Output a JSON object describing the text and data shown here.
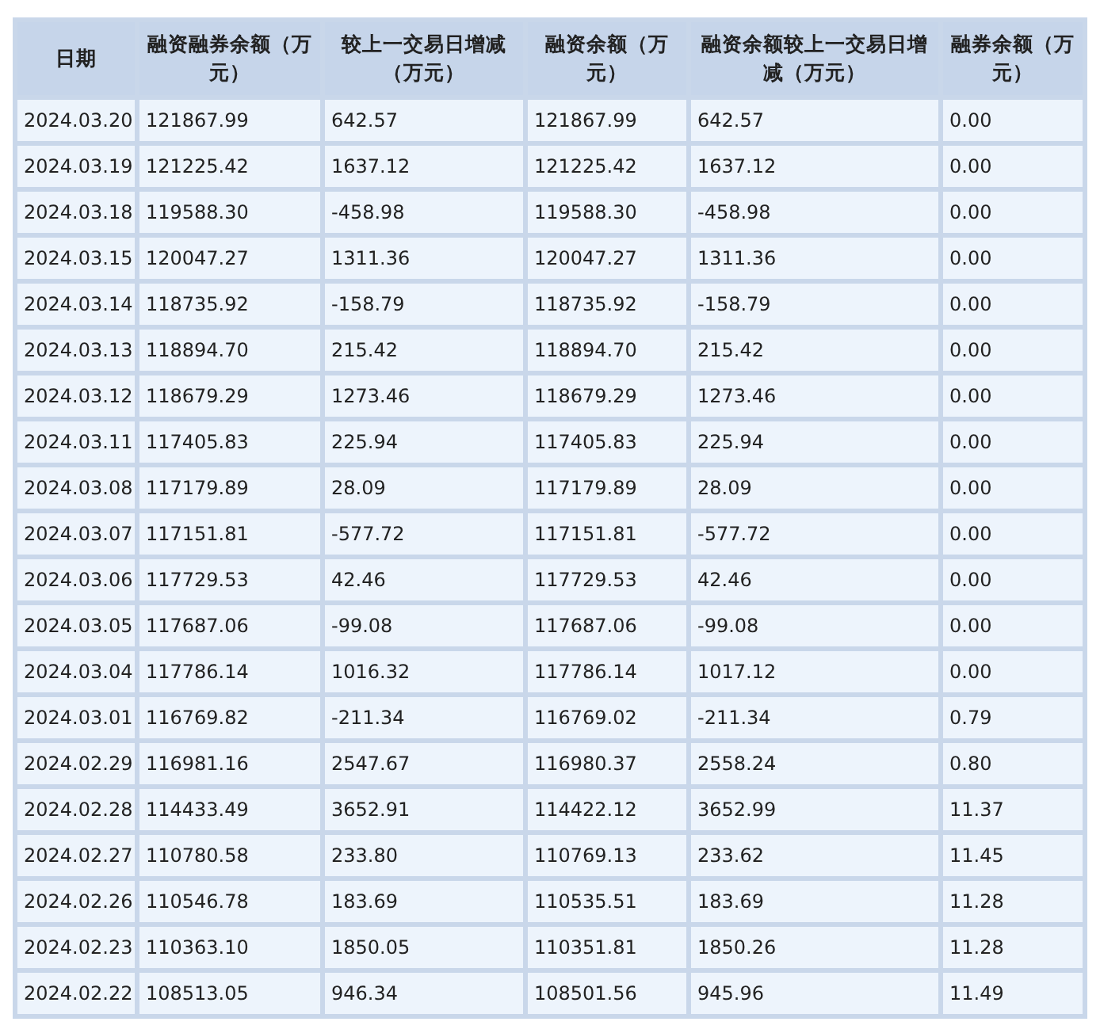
{
  "table": {
    "columns": [
      "日期",
      "融资融券余额（万元）",
      "较上一交易日增减（万元）",
      "融资余额（万元）",
      "融资余额较上一交易日增减（万元）",
      "融券余额（万元）"
    ],
    "rows": [
      [
        "2024.03.20",
        "121867.99",
        "642.57",
        "121867.99",
        "642.57",
        "0.00"
      ],
      [
        "2024.03.19",
        "121225.42",
        "1637.12",
        "121225.42",
        "1637.12",
        "0.00"
      ],
      [
        "2024.03.18",
        "119588.30",
        "-458.98",
        "119588.30",
        "-458.98",
        "0.00"
      ],
      [
        "2024.03.15",
        "120047.27",
        "1311.36",
        "120047.27",
        "1311.36",
        "0.00"
      ],
      [
        "2024.03.14",
        "118735.92",
        "-158.79",
        "118735.92",
        "-158.79",
        "0.00"
      ],
      [
        "2024.03.13",
        "118894.70",
        "215.42",
        "118894.70",
        "215.42",
        "0.00"
      ],
      [
        "2024.03.12",
        "118679.29",
        "1273.46",
        "118679.29",
        "1273.46",
        "0.00"
      ],
      [
        "2024.03.11",
        "117405.83",
        "225.94",
        "117405.83",
        "225.94",
        "0.00"
      ],
      [
        "2024.03.08",
        "117179.89",
        "28.09",
        "117179.89",
        "28.09",
        "0.00"
      ],
      [
        "2024.03.07",
        "117151.81",
        "-577.72",
        "117151.81",
        "-577.72",
        "0.00"
      ],
      [
        "2024.03.06",
        "117729.53",
        "42.46",
        "117729.53",
        "42.46",
        "0.00"
      ],
      [
        "2024.03.05",
        "117687.06",
        "-99.08",
        "117687.06",
        "-99.08",
        "0.00"
      ],
      [
        "2024.03.04",
        "117786.14",
        "1016.32",
        "117786.14",
        "1017.12",
        "0.00"
      ],
      [
        "2024.03.01",
        "116769.82",
        "-211.34",
        "116769.02",
        "-211.34",
        "0.79"
      ],
      [
        "2024.02.29",
        "116981.16",
        "2547.67",
        "116980.37",
        "2558.24",
        "0.80"
      ],
      [
        "2024.02.28",
        "114433.49",
        "3652.91",
        "114422.12",
        "3652.99",
        "11.37"
      ],
      [
        "2024.02.27",
        "110780.58",
        "233.80",
        "110769.13",
        "233.62",
        "11.45"
      ],
      [
        "2024.02.26",
        "110546.78",
        "183.69",
        "110535.51",
        "183.69",
        "11.28"
      ],
      [
        "2024.02.23",
        "110363.10",
        "1850.05",
        "110351.81",
        "1850.26",
        "11.28"
      ],
      [
        "2024.02.22",
        "108513.05",
        "946.34",
        "108501.56",
        "945.96",
        "11.49"
      ]
    ]
  }
}
